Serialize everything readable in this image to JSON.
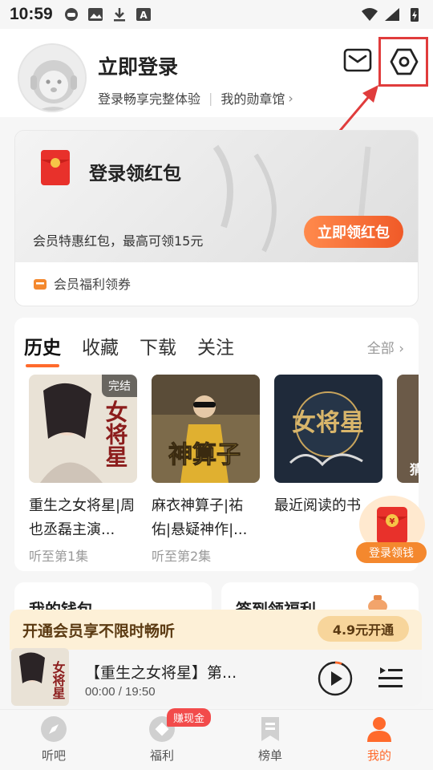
{
  "status_bar": {
    "time": "10:59"
  },
  "profile": {
    "title": "立即登录",
    "subtitle": "登录畅享完整体验",
    "medals_link": "我的勋章馆",
    "medals_chevron": "›"
  },
  "red_packet": {
    "title": "登录领红包",
    "description": "会员特惠红包，最高可领15元",
    "button": "立即领红包",
    "coupon_label": "会员福利领券"
  },
  "history": {
    "tabs": [
      {
        "label": "历史",
        "active": true
      },
      {
        "label": "收藏",
        "active": false
      },
      {
        "label": "下载",
        "active": false
      },
      {
        "label": "关注",
        "active": false
      }
    ],
    "all_label": "全部 ›",
    "books": [
      {
        "title": "重生之女将星|周也丞磊主演...",
        "progress": "听至第1集",
        "badge": "完结",
        "cover_text": "女将星"
      },
      {
        "title": "麻衣神算子|祐佑|悬疑神作|...",
        "progress": "听至第2集",
        "badge": "",
        "cover_text": "神算子"
      },
      {
        "title": "最近阅读的书",
        "progress": "",
        "badge": "",
        "cover_text": "女将星"
      },
      {
        "title": "",
        "progress": "",
        "badge": "",
        "cover_text": "猜"
      }
    ]
  },
  "float_gift": {
    "label": "登录领钱"
  },
  "cards": {
    "wallet": "我的钱包",
    "checkin": "签到领福利"
  },
  "vip_bar": {
    "text": "开通会员享不限时畅听",
    "button": "4.9元开通"
  },
  "player": {
    "title": "【重生之女将星】第...",
    "time": "00:00 / 19:50",
    "cover_text": "女将星"
  },
  "tab_bar": {
    "items": [
      {
        "label": "听吧",
        "icon": "compass-icon",
        "active": false
      },
      {
        "label": "福利",
        "icon": "gift-icon",
        "active": false
      },
      {
        "label": "榜单",
        "icon": "bookmark-icon",
        "active": false
      },
      {
        "label": "我的",
        "icon": "person-icon",
        "active": true
      }
    ],
    "earn_badge": "赚现金"
  },
  "colors": {
    "accent": "#ff6a2c",
    "highlight_red": "#e03c3c",
    "vip_bg": "#fdf0d7"
  }
}
